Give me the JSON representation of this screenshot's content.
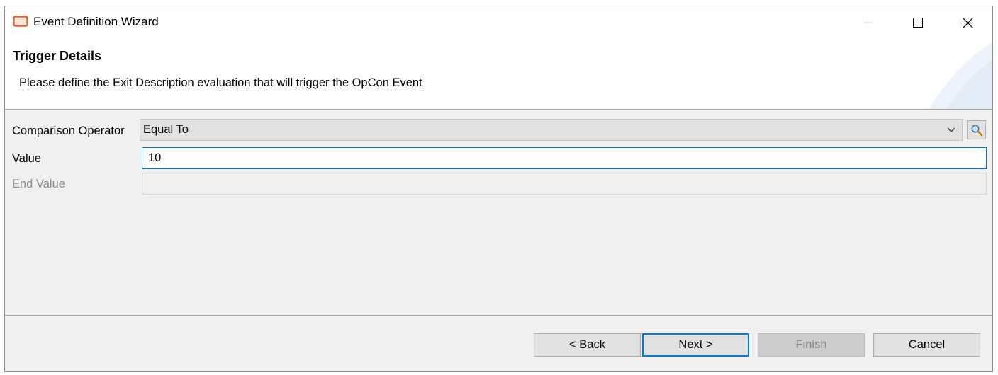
{
  "window": {
    "title": "Event Definition Wizard",
    "app_icon": "opcon-frame-icon"
  },
  "banner": {
    "title": "Trigger Details",
    "description": "Please define the Exit Description evaluation that will trigger the OpCon Event"
  },
  "form": {
    "comparison_operator": {
      "label": "Comparison Operator",
      "selected": "Equal To",
      "lookup_icon": "magnifier-icon"
    },
    "value": {
      "label": "Value",
      "current": "10"
    },
    "end_value": {
      "label": "End Value",
      "current": "",
      "disabled": true
    }
  },
  "buttons": {
    "back": "< Back",
    "next": "Next >",
    "finish": "Finish",
    "cancel": "Cancel"
  },
  "colors": {
    "accent": "#0078d7",
    "icon_orange": "#e8622a"
  }
}
